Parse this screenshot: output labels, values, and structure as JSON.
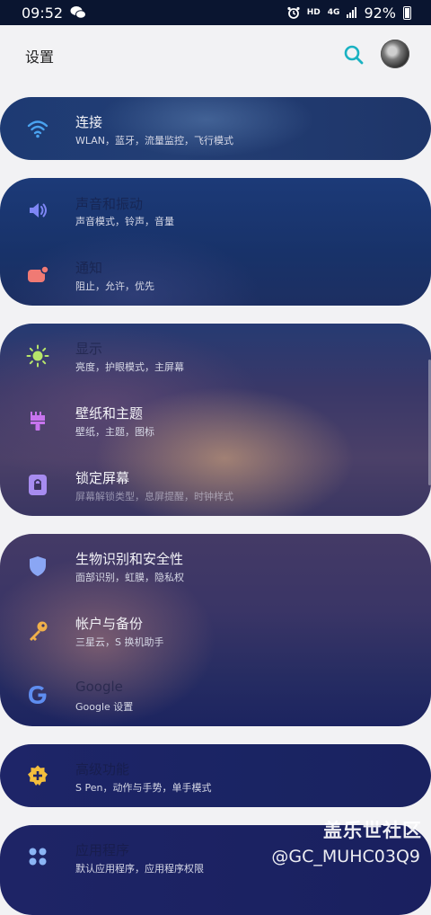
{
  "status_bar": {
    "time": "09:52",
    "hd": "HD",
    "network": "4G",
    "battery": "92%"
  },
  "header": {
    "title": "设置"
  },
  "groups": [
    {
      "items": [
        {
          "title": "连接",
          "subtitle": "WLAN，蓝牙，流量监控，飞行模式",
          "icon": "wifi-icon",
          "color": "#4aa3f0"
        }
      ]
    },
    {
      "items": [
        {
          "title": "声音和振动",
          "subtitle": "声音模式，铃声，音量",
          "icon": "speaker-icon",
          "color": "#7e86f5"
        },
        {
          "title": "通知",
          "subtitle": "阻止，允许，优先",
          "icon": "notification-icon",
          "color": "#f07a74"
        }
      ]
    },
    {
      "items": [
        {
          "title": "显示",
          "subtitle": "亮度，护眼模式，主屏幕",
          "icon": "brightness-icon",
          "color": "#b7e66a"
        },
        {
          "title": "壁纸和主题",
          "subtitle": "壁纸，主题，图标",
          "icon": "brush-icon",
          "color": "#c774ee"
        },
        {
          "title": "锁定屏幕",
          "subtitle": "屏幕解锁类型，息屏提醒，时钟样式",
          "icon": "lock-icon",
          "color": "#a78cf0"
        }
      ]
    },
    {
      "items": [
        {
          "title": "生物识别和安全性",
          "subtitle": "面部识别，虹膜，隐私权",
          "icon": "shield-icon",
          "color": "#8aa6f4"
        },
        {
          "title": "帐户与备份",
          "subtitle": "三星云，S 换机助手",
          "icon": "key-icon",
          "color": "#f0b04a"
        },
        {
          "title": "Google",
          "subtitle": "Google 设置",
          "icon": "google-icon",
          "color": "#5e8df0"
        }
      ]
    },
    {
      "items": [
        {
          "title": "高级功能",
          "subtitle": "S Pen，动作与手势，单手模式",
          "icon": "advanced-features-icon",
          "color": "#f3be3c"
        }
      ]
    },
    {
      "items": [
        {
          "title": "应用程序",
          "subtitle": "默认应用程序，应用程序权限",
          "icon": "apps-icon",
          "color": "#8bb5f5"
        }
      ]
    }
  ],
  "watermark": {
    "brand": "盖乐世社区",
    "user": "@GC_MUHC03Q9"
  }
}
